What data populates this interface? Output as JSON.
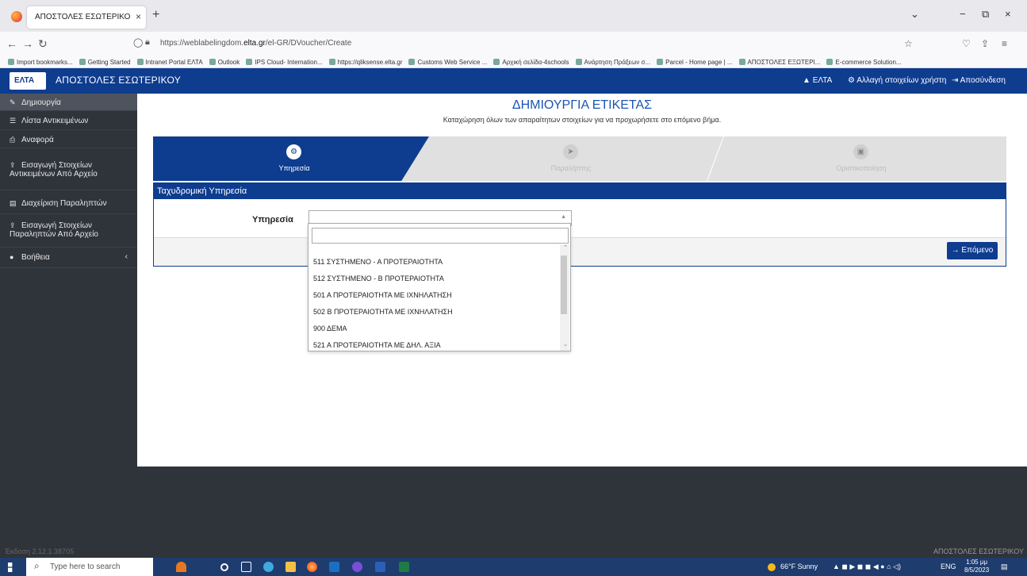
{
  "browser": {
    "tab_title": "ΑΠΟΣΤΟΛΕΣ ΕΣΩΤΕΡΙΚΟΥ - Δημιου",
    "url_prefix": "https://weblabelingdom.",
    "url_host": "elta.gr",
    "url_suffix": "/el-GR/DVoucher/Create",
    "bookmarks": [
      "Import bookmarks...",
      "Getting Started",
      "Intranet Portal ΕΛΤΑ",
      "Outlook",
      "IPS Cloud- Internation...",
      "https://qliksense.elta.gr",
      "Customs Web Service ...",
      "Αρχική σελίδα-4schools",
      "Ανάρτηση Πράξεων σ...",
      "Parcel - Home page | ...",
      "ΑΠΟΣΤΟΛΕΣ ΕΞΩΤΕΡΙ...",
      "E-commerce Solution..."
    ]
  },
  "header": {
    "logo_text": "ΕΛΤΑ",
    "title": "ΑΠΟΣΤΟΛΕΣ ΕΣΩΤΕΡΙΚΟΥ",
    "user": "ΕΛΤΑ",
    "change_user": "Αλλαγή στοιχείων χρήστη",
    "logout": "Αποσύνδεση"
  },
  "sidebar": {
    "items": [
      {
        "label": "Δημιουργία",
        "icon": "edit-icon"
      },
      {
        "label": "Λίστα Αντικειμένων",
        "icon": "list-icon"
      },
      {
        "label": "Αναφορά",
        "icon": "print-icon"
      },
      {
        "label": "Εισαγωγή Στοιχείων Αντικειμένων Από Αρχείο",
        "icon": "upload-icon"
      },
      {
        "label": "Διαχείριση Παραληπτών",
        "icon": "card-icon"
      },
      {
        "label": "Εισαγωγή Στοιχείων Παραληπτών Από Αρχείο",
        "icon": "upload-icon"
      },
      {
        "label": "Βοήθεια",
        "icon": "question-icon"
      }
    ]
  },
  "main": {
    "title": "ΔΗΜΙΟΥΡΓΙΑ ΕΤΙΚΕΤΑΣ",
    "subtitle": "Καταχώρηση όλων των απαραίτητων στοιχείων για να προχωρήσετε στο επόμενο βήμα.",
    "steps": [
      "Υπηρεσία",
      "Παραλήπτης",
      "Οριστικοποίηση"
    ],
    "panel_title": "Ταχυδρομική Υπηρεσία",
    "field_label": "Υπηρεσία",
    "next_button": "Επόμενο",
    "options": [
      "511 ΣΥΣΤΗΜΕΝΟ - Α ΠΡΟΤΕΡΑΙΟΤΗΤΑ",
      "512 ΣΥΣΤΗΜΕΝΟ - Β ΠΡΟΤΕΡΑΙΟΤΗΤΑ",
      "501 Α ΠΡΟΤΕΡΑΙΟΤΗΤΑ ΜΕ ΙΧΝΗΛΑΤΗΣΗ",
      "502 Β ΠΡΟΤΕΡΑΙΟΤΗΤΑ ΜΕ ΙΧΝΗΛΑΤΗΣΗ",
      "900 ΔΕΜΑ",
      "521 Α ΠΡΟΤΕΡΑΙΟΤΗΤΑ ΜΕ ΔΗΛ. ΑΞΙΑ"
    ]
  },
  "footer": {
    "version": "Έκδοση 2.12.1.38705",
    "app": "ΑΠΟΣΤΟΛΕΣ ΕΣΩΤΕΡΙΚΟΥ"
  },
  "taskbar": {
    "search_placeholder": "Type here to search",
    "weather": "66°F Sunny",
    "lang": "ENG",
    "time": "1:05 μμ",
    "date": "8/5/2023"
  },
  "colors": {
    "brand": "#0e3c8f",
    "sidebar": "#2f333a"
  }
}
